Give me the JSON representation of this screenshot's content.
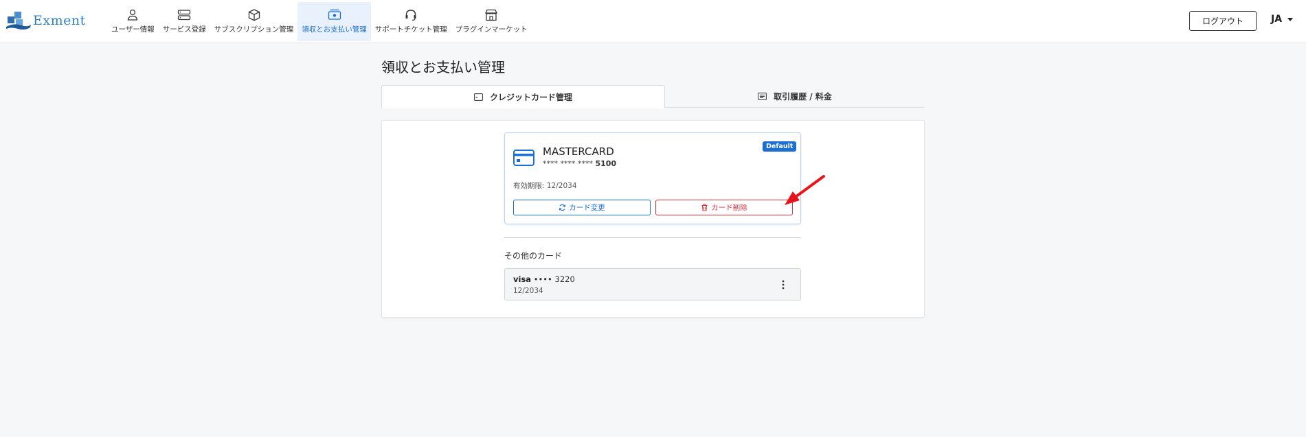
{
  "header": {
    "logo_text": "Exment",
    "nav": [
      {
        "label": "ユーザー情報",
        "icon": "user-icon",
        "active": false
      },
      {
        "label": "サービス登録",
        "icon": "server-icon",
        "active": false
      },
      {
        "label": "サブスクリプション管理",
        "icon": "box-icon",
        "active": false
      },
      {
        "label": "領収とお支払い管理",
        "icon": "money-icon",
        "active": true
      },
      {
        "label": "サポートチケット管理",
        "icon": "headset-icon",
        "active": false
      },
      {
        "label": "プラグインマーケット",
        "icon": "store-icon",
        "active": false
      }
    ],
    "logout_label": "ログアウト",
    "language": "JA"
  },
  "page": {
    "title": "領収とお支払い管理",
    "tabs": [
      {
        "label": "クレジットカード管理",
        "icon": "credit-card-icon",
        "active": true
      },
      {
        "label": "取引履歴 / 料金",
        "icon": "list-icon",
        "active": false
      }
    ]
  },
  "default_card": {
    "brand": "MASTERCARD",
    "masked_prefix": "**** **** ****",
    "last4": "5100",
    "badge": "Default",
    "expiry": "有効期限: 12/2034",
    "change_label": "カード変更",
    "delete_label": "カード削除"
  },
  "other_cards": {
    "title": "その他のカード",
    "items": [
      {
        "brand": "visa",
        "masked": "••••",
        "last4": "3220",
        "expiry": "12/2034"
      }
    ]
  },
  "colors": {
    "accent": "#1a6fd4",
    "danger": "#d9303a",
    "annotation_arrow": "#e8141c"
  }
}
